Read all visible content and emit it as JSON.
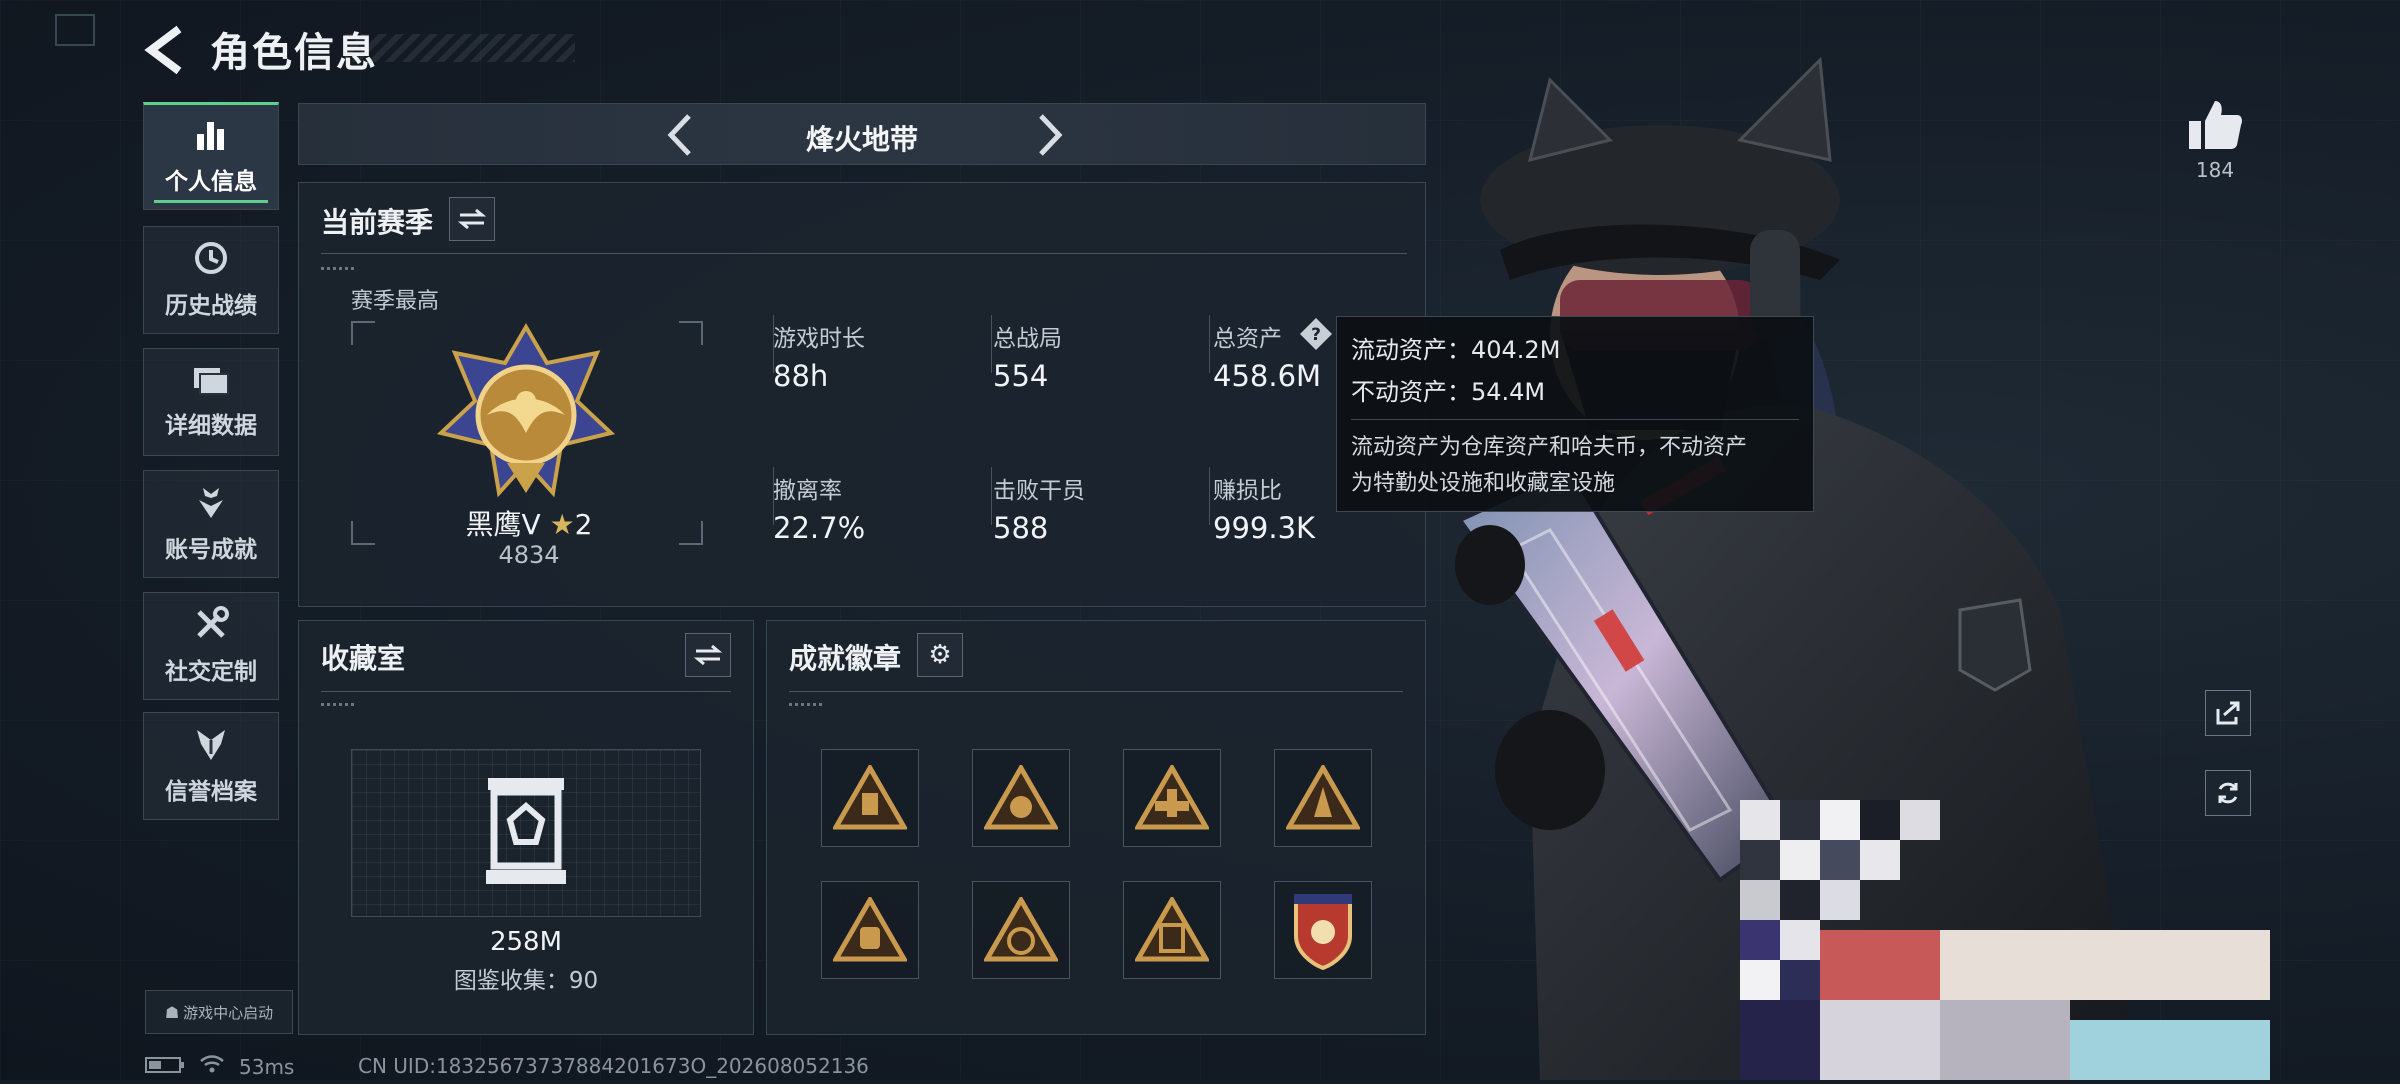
{
  "header": {
    "title": "角色信息"
  },
  "nav": [
    {
      "label": "个人信息",
      "icon": "bar-chart-icon"
    },
    {
      "label": "历史战绩",
      "icon": "history-icon"
    },
    {
      "label": "详细数据",
      "icon": "folder-icon"
    },
    {
      "label": "账号成就",
      "icon": "achievement-icon"
    },
    {
      "label": "社交定制",
      "icon": "tools-icon"
    },
    {
      "label": "信誉档案",
      "icon": "reputation-icon"
    }
  ],
  "game_center": {
    "label": "游戏中心启动"
  },
  "mode": {
    "name": "烽火地带"
  },
  "season": {
    "title": "当前赛季",
    "best_label": "赛季最高",
    "rank_name": "黑鹰Ⅴ",
    "rank_stars": "2",
    "rank_score": "4834",
    "stats": [
      {
        "label": "游戏时长",
        "value": "88h"
      },
      {
        "label": "总战局",
        "value": "554"
      },
      {
        "label": "总资产",
        "value": "458.6M"
      },
      {
        "label": "撤离率",
        "value": "22.7%"
      },
      {
        "label": "击败干员",
        "value": "588"
      },
      {
        "label": "赚损比",
        "value": "999.3K"
      }
    ]
  },
  "tooltip": {
    "liquid": "流动资产：404.2M",
    "fixed": "不动资产：54.4M",
    "desc_line1": "流动资产为仓库资产和哈夫币，不动资产",
    "desc_line2": "为特勤处设施和收藏室设施"
  },
  "collection": {
    "title": "收藏室",
    "value": "258M",
    "catalog": "图鉴收集：90"
  },
  "badges": {
    "title": "成就徽章",
    "count": 8
  },
  "social": {
    "likes": "184"
  },
  "status": {
    "ping": "53ms",
    "uid": "CN UID:18325673737884201673O_202608052136"
  },
  "colors": {
    "accent": "#5fd08c",
    "gold": "#c9a24a",
    "panel": "#1c242e"
  }
}
